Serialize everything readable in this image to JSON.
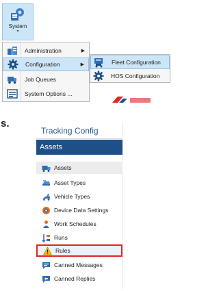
{
  "ribbon": {
    "system_label": "System",
    "system_icon": "system-gear-icon"
  },
  "menu": {
    "items": [
      {
        "label": "Administration",
        "icon": "administration-icon",
        "has_submenu": true
      },
      {
        "label": "Configuration",
        "icon": "gear-icon",
        "has_submenu": true,
        "active": true
      },
      {
        "label": "Job Queues",
        "icon": "job-queues-icon",
        "has_submenu": false
      },
      {
        "label": "System Options ...",
        "icon": "system-options-icon",
        "has_submenu": false
      }
    ]
  },
  "submenu": {
    "items": [
      {
        "label": "Fleet Configuration",
        "icon": "fleet-configuration-icon",
        "active": true
      },
      {
        "label": "HOS Configuration",
        "icon": "gear-icon"
      }
    ]
  },
  "stray_text": "s.",
  "panel": {
    "title": "Tracking Config",
    "header": "Assets",
    "items": [
      {
        "label": "Assets",
        "icon": "truck-icon",
        "selected": true
      },
      {
        "label": "Asset Types",
        "icon": "asset-types-icon"
      },
      {
        "label": "Vehicle Types",
        "icon": "vehicle-types-icon"
      },
      {
        "label": "Device Data Settings",
        "icon": "device-data-icon"
      },
      {
        "label": "Work Schedules",
        "icon": "work-schedules-icon"
      },
      {
        "label": "Runs",
        "icon": "runs-icon"
      },
      {
        "label": "Rules",
        "icon": "warning-icon",
        "highlighted": true
      },
      {
        "label": "Canned Messages",
        "icon": "chat-icon"
      },
      {
        "label": "Canned Replies",
        "icon": "chat-reply-icon"
      }
    ]
  },
  "colors": {
    "accent": "#1e4f86",
    "highlight_border": "#e02424",
    "menu_active": "#cde6f7"
  }
}
